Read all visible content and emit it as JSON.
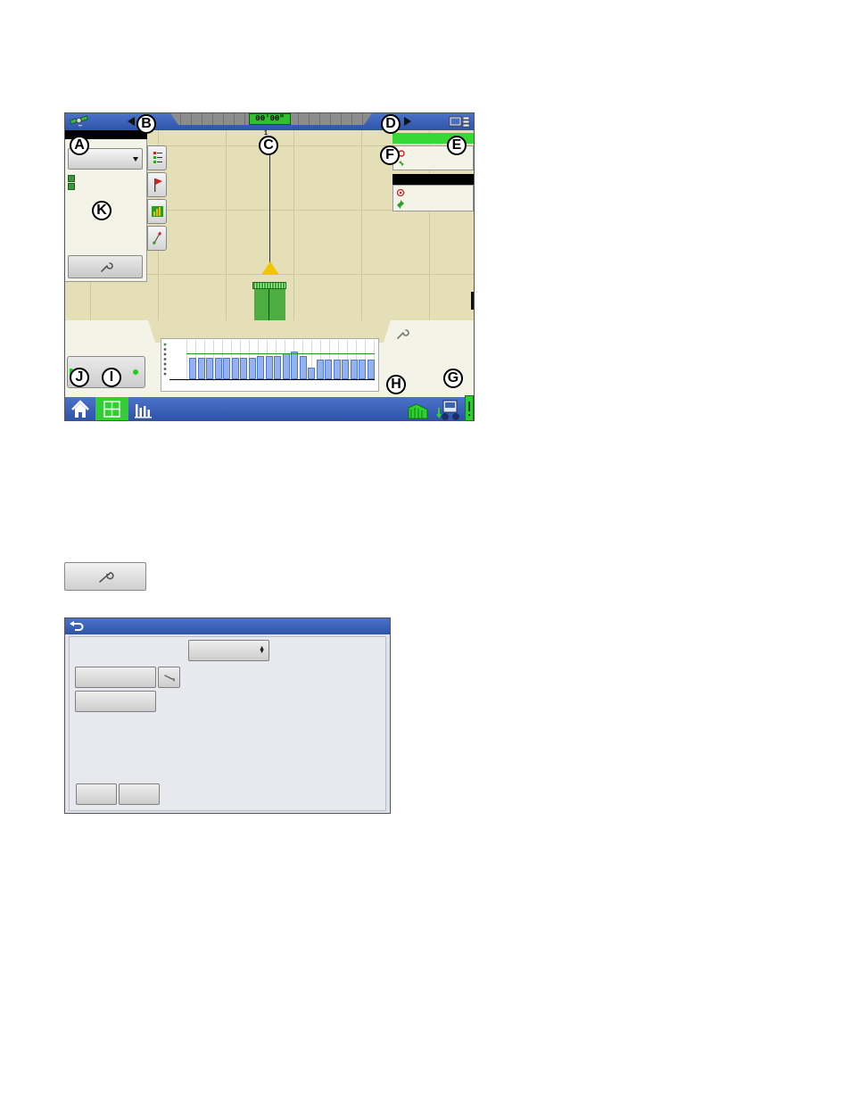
{
  "screen1": {
    "lightbar": {
      "offset_text": "00'00\"",
      "guidance_number": "1"
    },
    "callouts": [
      "A",
      "B",
      "C",
      "D",
      "E",
      "F",
      "G",
      "H",
      "I",
      "J",
      "K"
    ]
  },
  "colors": {
    "bar_blue": "#2e54a9",
    "lightbar_green": "#2ec02e",
    "coverage_green": "#4cae40",
    "map_bg": "#e4dfb6",
    "rate_bars": "#93b2f2"
  },
  "icons": {
    "gps": "satellite-icon",
    "wrench": "wrench-icon",
    "home": "home-icon",
    "layout": "layout-grid-icon",
    "charts": "bar-chart-icon",
    "field": "field-icon",
    "vehicle": "vehicle-icon",
    "back": "back-arrow-icon"
  },
  "rate_chart": {
    "target": 0.65,
    "values": [
      0.55,
      0.55,
      0.55,
      0.55,
      0.55,
      0.55,
      0.55,
      0.55,
      0.6,
      0.6,
      0.6,
      0.65,
      0.7,
      0.6,
      0.3,
      0.5,
      0.5,
      0.5,
      0.5,
      0.5,
      0.5,
      0.5
    ]
  }
}
